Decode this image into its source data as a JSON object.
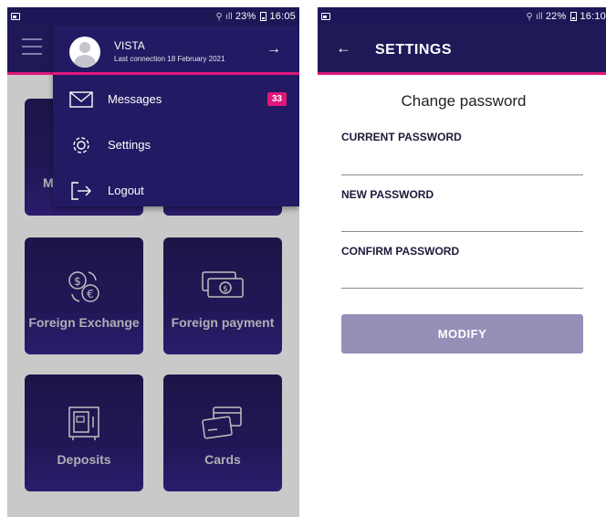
{
  "left_screen": {
    "status_bar": {
      "battery": "23%",
      "time": "16:05"
    },
    "drawer": {
      "user_name": "VISTA",
      "last_connection": "Last connection 18 February 2021",
      "items": [
        {
          "label": "Messages",
          "icon": "envelope-icon",
          "badge": "33"
        },
        {
          "label": "Settings",
          "icon": "gear-icon"
        },
        {
          "label": "Logout",
          "icon": "logout-icon"
        }
      ]
    },
    "tiles": [
      {
        "label": "M",
        "icon": "messages-icon"
      },
      {
        "label": "",
        "icon": ""
      },
      {
        "label": "Foreign Exchange",
        "icon": "currency-exchange-icon"
      },
      {
        "label": "Foreign payment",
        "icon": "banknotes-icon"
      },
      {
        "label": "Deposits",
        "icon": "safe-icon"
      },
      {
        "label": "Cards",
        "icon": "cards-icon"
      }
    ]
  },
  "right_screen": {
    "status_bar": {
      "battery": "22%",
      "time": "16:10"
    },
    "header": {
      "title": "SETTINGS"
    },
    "form": {
      "title": "Change password",
      "current_password_label": "CURRENT PASSWORD",
      "new_password_label": "NEW PASSWORD",
      "confirm_password_label": "CONFIRM PASSWORD",
      "modify_button": "MODIFY"
    }
  },
  "colors": {
    "primary": "#1f1958",
    "accent": "#e0177a",
    "button_disabled": "#9490b8",
    "overlay_background": "#c9c9c9"
  }
}
